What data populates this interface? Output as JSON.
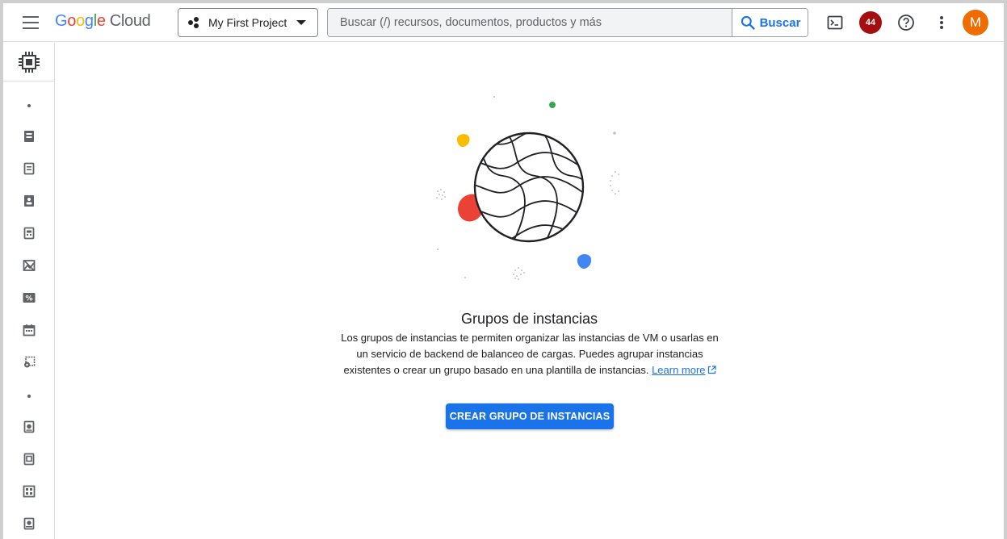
{
  "header": {
    "logo": {
      "letters": [
        "G",
        "o",
        "o",
        "g",
        "l",
        "e"
      ],
      "letter_colors": [
        "#4285f4",
        "#ea4335",
        "#fbbc04",
        "#4285f4",
        "#34a853",
        "#ea4335"
      ],
      "product": "Cloud"
    },
    "project": "My First Project",
    "search": {
      "placeholder": "Buscar (/) recursos, documentos, productos y más",
      "button_label": "Buscar"
    },
    "notifications_count": "44",
    "avatar_initial": "M",
    "icons": [
      "menu-icon",
      "project-icon",
      "search-icon",
      "terminal-icon",
      "help-icon",
      "more-vert-icon"
    ]
  },
  "rail": {
    "product_icon": "compute-engine-icon",
    "items": [
      "vm-instances-icon",
      "instance-templates-icon",
      "sole-tenant-nodes-icon",
      "machine-images-icon",
      "tpus-icon",
      "committed-use-discounts-icon",
      "reservations-icon",
      "migrate-icon",
      "disks-icon",
      "snapshots-icon",
      "images-icon",
      "storage-pools-icon"
    ]
  },
  "main": {
    "title": "Grupos de instancias",
    "description": "Los grupos de instancias te permiten organizar las instancias de VM o usarlas en un servicio de backend de balanceo de cargas. Puedes agrupar instancias existentes o crear un grupo basado en una plantilla de instancias.",
    "learn_more": "Learn more",
    "create_button": "CREAR GRUPO DE INSTANCIAS"
  },
  "colors": {
    "accent": "#1a73e8",
    "badge": "#a50e0e",
    "avatar": "#ef6c00",
    "blob_yellow": "#fbbc04",
    "blob_red": "#ea4335",
    "blob_blue": "#4285f4",
    "dot_green": "#34a853"
  }
}
